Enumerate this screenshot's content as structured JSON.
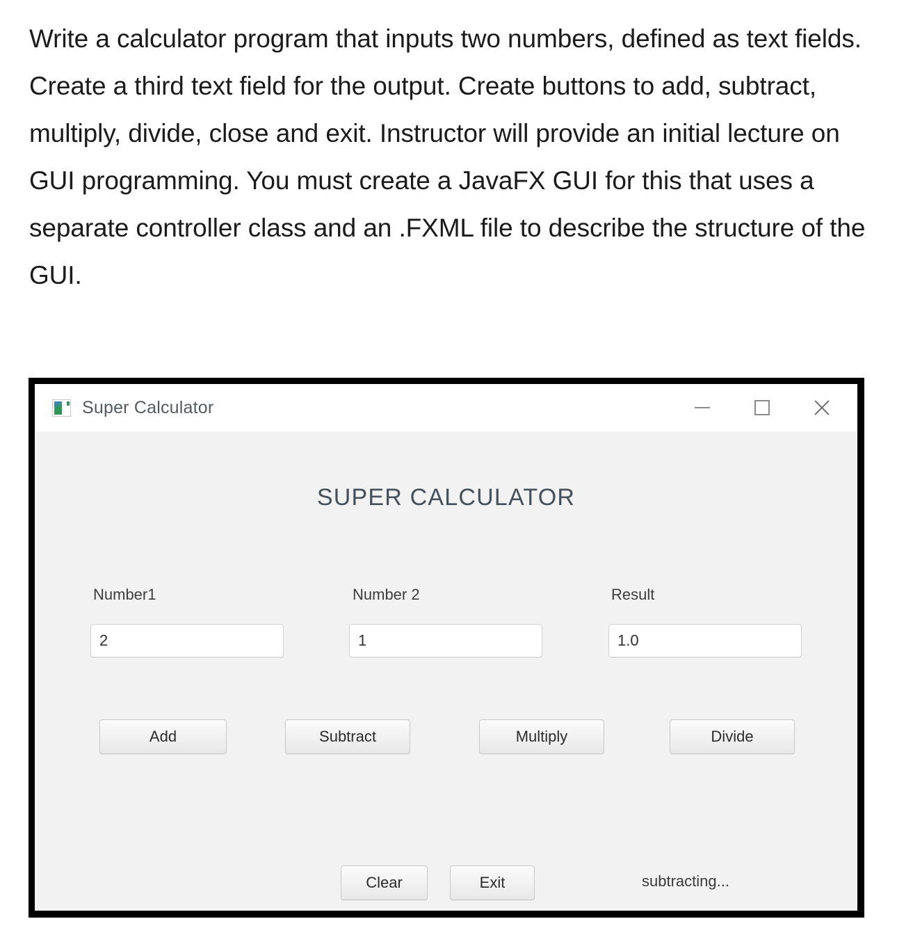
{
  "prompt": {
    "text": "Write a calculator program that inputs two numbers, defined as text fields. Create a third text field for the output.  Create buttons to add, subtract, multiply, divide, close and exit. Instructor will provide an initial lecture on GUI programming. You must create a JavaFX GUI for this that uses a separate controller class and an .FXML file to describe the structure of the GUI."
  },
  "window": {
    "titlebar": {
      "title": "Super Calculator",
      "icon": "app-window-icon",
      "minimize_label": "",
      "maximize_label": "",
      "close_label": ""
    },
    "heading": "SUPER CALCULATOR",
    "fields": [
      {
        "label": "Number1",
        "value": "2"
      },
      {
        "label": "Number 2",
        "value": "1"
      },
      {
        "label": "Result",
        "value": "1.0"
      }
    ],
    "operation_buttons": [
      {
        "label": "Add"
      },
      {
        "label": "Subtract"
      },
      {
        "label": "Multiply"
      },
      {
        "label": "Divide"
      }
    ],
    "action_buttons": [
      {
        "label": "Clear"
      },
      {
        "label": "Exit"
      }
    ],
    "status": "subtracting...",
    "colors": {
      "frame": "#000000",
      "client_bg": "#f2f2f2",
      "titlebar_bg": "#ffffff",
      "heading_text": "#44505c",
      "body_text": "#1b1b1b"
    }
  }
}
